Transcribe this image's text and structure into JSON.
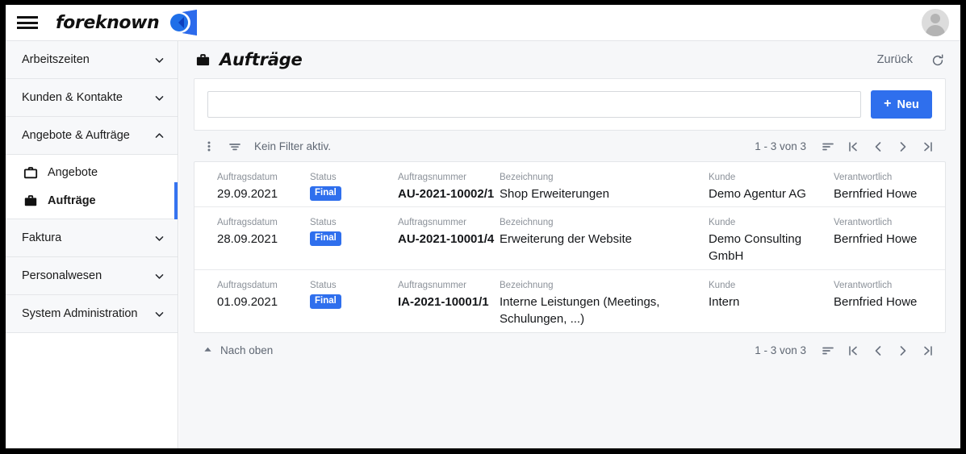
{
  "topbar": {
    "menu_icon": "hamburger-icon",
    "brand_name": "foreknown",
    "logo_icon": "foreknown-logo",
    "avatar_icon": "user-avatar"
  },
  "sidebar": {
    "groups": [
      {
        "label": "Arbeitszeiten",
        "expanded": false,
        "icon": "chevron-down-icon"
      },
      {
        "label": "Kunden & Kontakte",
        "expanded": false,
        "icon": "chevron-down-icon"
      },
      {
        "label": "Angebote & Aufträge",
        "expanded": true,
        "icon": "chevron-up-icon"
      },
      {
        "label": "Faktura",
        "expanded": false,
        "icon": "chevron-down-icon"
      },
      {
        "label": "Personalwesen",
        "expanded": false,
        "icon": "chevron-down-icon"
      },
      {
        "label": "System Administration",
        "expanded": false,
        "icon": "chevron-down-icon"
      }
    ],
    "sub_items": [
      {
        "label": "Angebote",
        "icon": "briefcase-outline-icon",
        "active": false
      },
      {
        "label": "Aufträge",
        "icon": "briefcase-filled-icon",
        "active": true
      }
    ]
  },
  "page": {
    "title": "Aufträge",
    "title_icon": "briefcase-filled-icon",
    "back_label": "Zurück",
    "refresh_icon": "refresh-icon"
  },
  "search": {
    "value": "",
    "placeholder": "",
    "new_button_label": "Neu",
    "new_button_icon": "plus-icon"
  },
  "toolbar": {
    "menu_icon": "more-vertical-icon",
    "filter_icon": "filter-icon",
    "filter_text": "Kein Filter aktiv.",
    "range_text": "1 - 3 von 3",
    "sort_icon": "sort-icon",
    "first_icon": "first-page-icon",
    "prev_icon": "previous-page-icon",
    "next_icon": "next-page-icon",
    "last_icon": "last-page-icon"
  },
  "table": {
    "columns": [
      {
        "key": "auftragsdatum",
        "label": "Auftragsdatum"
      },
      {
        "key": "status",
        "label": "Status"
      },
      {
        "key": "auftragsnummer",
        "label": "Auftragsnummer"
      },
      {
        "key": "bezeichnung",
        "label": "Bezeichnung"
      },
      {
        "key": "kunde",
        "label": "Kunde"
      },
      {
        "key": "verantwortlich",
        "label": "Verantwortlich"
      }
    ],
    "rows": [
      {
        "auftragsdatum": "29.09.2021",
        "status": "Final",
        "auftragsnummer": "AU-2021-10002/1",
        "bezeichnung": "Shop Erweiterungen",
        "kunde": "Demo Agentur AG",
        "verantwortlich": "Bernfried Howe"
      },
      {
        "auftragsdatum": "28.09.2021",
        "status": "Final",
        "auftragsnummer": "AU-2021-10001/4",
        "bezeichnung": "Erweiterung der Website",
        "kunde": "Demo Consulting GmbH",
        "verantwortlich": "Bernfried Howe"
      },
      {
        "auftragsdatum": "01.09.2021",
        "status": "Final",
        "auftragsnummer": "IA-2021-10001/1",
        "bezeichnung": "Interne Leistungen (Meetings, Schulungen, ...)",
        "kunde": "Intern",
        "verantwortlich": "Bernfried Howe"
      }
    ]
  },
  "footer": {
    "top_label": "Nach oben",
    "top_icon": "arrow-up-icon",
    "range_text": "1 - 3 von 3",
    "sort_icon": "sort-icon",
    "first_icon": "first-page-icon",
    "prev_icon": "previous-page-icon",
    "next_icon": "next-page-icon",
    "last_icon": "last-page-icon"
  },
  "colors": {
    "accent": "#2f6fed",
    "badge": "#2f6fed",
    "active_bar": "#3573f0",
    "text": "#15171a",
    "muted": "#8b9199",
    "page_bg": "#f6f7f9"
  }
}
